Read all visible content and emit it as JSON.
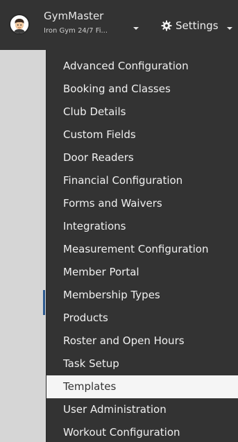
{
  "navbar": {
    "brand_name": "GymMaster",
    "brand_sub": "Iron Gym 24/7 Fi...",
    "settings_label": "Settings",
    "background": "#333333"
  },
  "icons": {
    "avatar": "avatar-icon",
    "brand_dropdown": "chevron-down-icon",
    "settings": "gear-icon",
    "settings_dropdown": "chevron-down-icon"
  },
  "menu": {
    "items": [
      {
        "label": "Advanced Configuration"
      },
      {
        "label": "Booking and Classes"
      },
      {
        "label": "Club Details"
      },
      {
        "label": "Custom Fields"
      },
      {
        "label": "Door Readers"
      },
      {
        "label": "Financial Configuration"
      },
      {
        "label": "Forms and Waivers"
      },
      {
        "label": "Integrations"
      },
      {
        "label": "Measurement Configuration"
      },
      {
        "label": "Member Portal"
      },
      {
        "label": "Membership Types"
      },
      {
        "label": "Products"
      },
      {
        "label": "Roster and Open Hours"
      },
      {
        "label": "Task Setup"
      },
      {
        "label": "Templates",
        "active": true
      },
      {
        "label": "User Administration"
      },
      {
        "label": "Workout Configuration"
      }
    ],
    "background": "#333333",
    "active_background": "#f5f5f5",
    "text_color": "#f0f0f0"
  }
}
